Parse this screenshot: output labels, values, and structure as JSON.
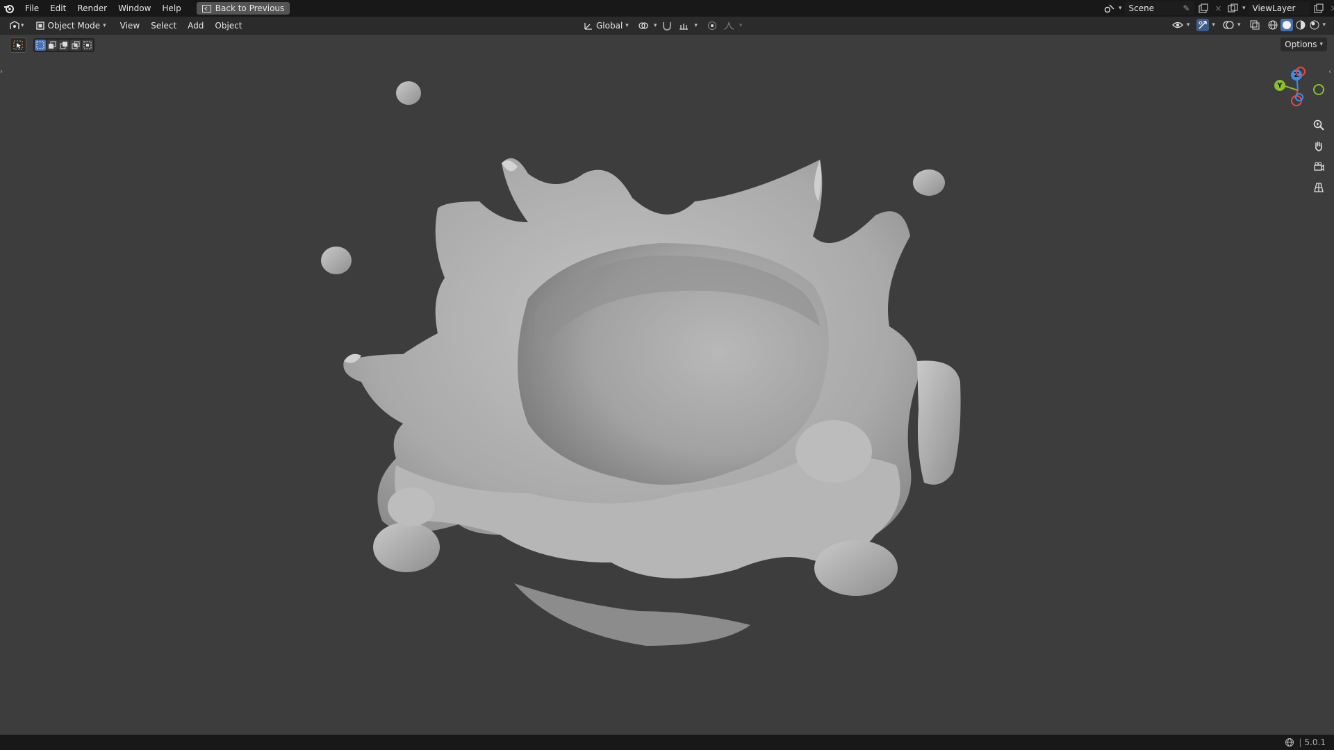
{
  "topbar": {
    "menus": [
      "File",
      "Edit",
      "Render",
      "Window",
      "Help"
    ],
    "back_button": "Back to Previous",
    "scene": "Scene",
    "view_layer": "ViewLayer"
  },
  "header": {
    "mode": "Object Mode",
    "menus": [
      "View",
      "Select",
      "Add",
      "Object"
    ],
    "transform_orientation": "Global",
    "options_label": "Options"
  },
  "gizmo": {
    "z_label": "Z",
    "y_label": "Y",
    "colors": {
      "x": "#e8474e",
      "y": "#8bbf2c",
      "z": "#3a8ee8"
    }
  },
  "status": {
    "version": "5.0.1"
  }
}
